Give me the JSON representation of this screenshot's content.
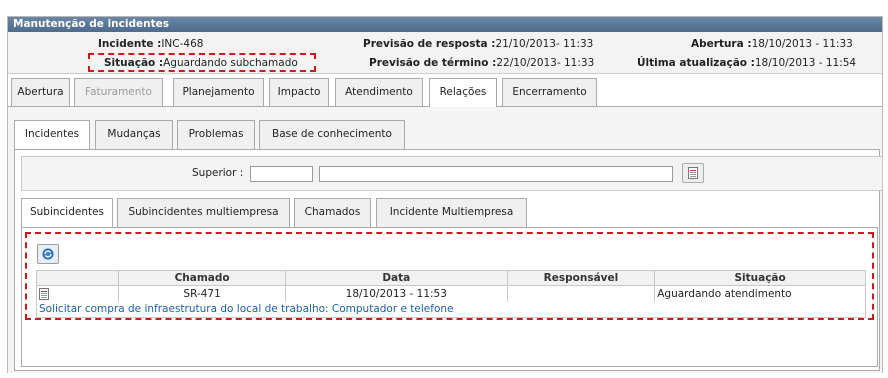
{
  "window": {
    "title": "Manutenção de incidentes"
  },
  "header": {
    "incidente_label": "Incidente :",
    "incidente_value": "INC-468",
    "situacao_label": "Situação :",
    "situacao_value": "Aguardando subchamado",
    "prev_resposta_label": "Previsão de resposta :",
    "prev_resposta_value": "21/10/2013- 11:33",
    "prev_termino_label": "Previsão de término :",
    "prev_termino_value": "22/10/2013- 11:33",
    "abertura_label": "Abertura :",
    "abertura_value": "18/10/2013 - 11:33",
    "ultima_label": "Última atualização :",
    "ultima_value": "18/10/2013 - 11:54"
  },
  "main_tabs": [
    "Abertura",
    "Faturamento",
    "Planejamento",
    "Impacto",
    "Atendimento",
    "Relações",
    "Encerramento"
  ],
  "sub_tabs": [
    "Incidentes",
    "Mudanças",
    "Problemas",
    "Base de conhecimento"
  ],
  "superior": {
    "label": "Superior :",
    "code_value": "",
    "desc_value": ""
  },
  "inner_tabs": [
    "Subincidentes",
    "Subincidentes multiempresa",
    "Chamados",
    "Incidente Multiempresa"
  ],
  "grid": {
    "columns": [
      "",
      "Chamado",
      "Data",
      "Responsável",
      "Situação"
    ],
    "rows": [
      {
        "chamado": "SR-471",
        "data": "18/10/2013 - 11:53",
        "responsavel": "",
        "situacao": "Aguardando atendimento",
        "descricao": "Solicitar compra de infraestrutura do local de trabalho: Computador e telefone"
      }
    ]
  },
  "colors": {
    "title_bg": "#5b7799",
    "highlight": "#d0191b",
    "link": "#1f5fa8"
  }
}
